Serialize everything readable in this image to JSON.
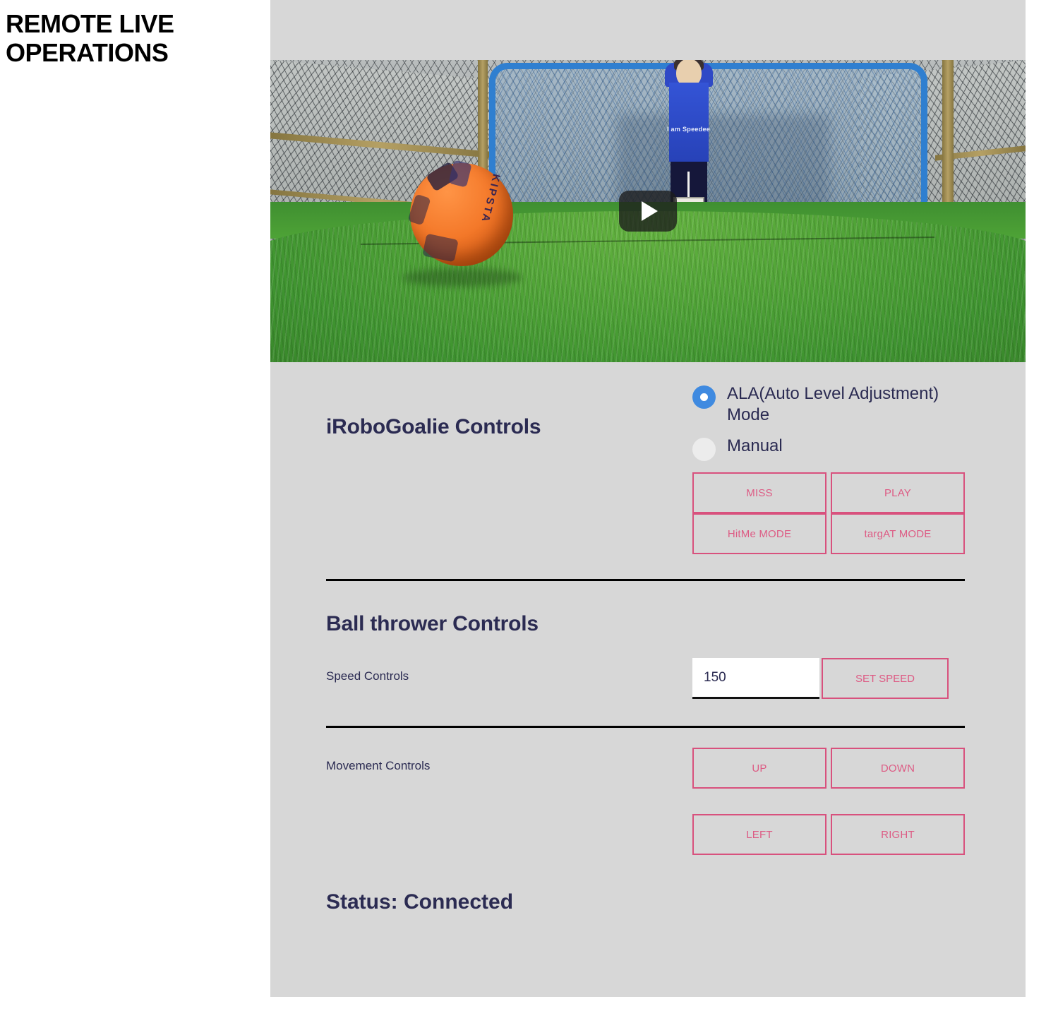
{
  "page": {
    "title": "REMOTE LIVE OPERATIONS",
    "background_color": "#ffffff",
    "card_color": "#d7d7d7"
  },
  "video": {
    "play_icon": "play-icon",
    "ball_brand": "KIPSTA",
    "goalie_text": "I am\nSpeedee"
  },
  "robogoalie": {
    "heading": "iRoboGoalie Controls",
    "modes": [
      {
        "label": "ALA(Auto Level Adjustment) Mode",
        "selected": true
      },
      {
        "label": "Manual",
        "selected": false
      }
    ],
    "buttons": [
      "MISS",
      "PLAY",
      "HitMe MODE",
      "targAT MODE"
    ]
  },
  "thrower": {
    "heading": "Ball thrower Controls",
    "speed_label": "Speed Controls",
    "speed_value": "150",
    "speed_placeholder": "150",
    "set_speed_label": "SET SPEED",
    "movement_label": "Movement Controls",
    "movement_buttons": [
      "UP",
      "DOWN",
      "LEFT",
      "RIGHT"
    ]
  },
  "status": {
    "text": "Status: Connected"
  },
  "colors": {
    "accent_pink": "#d8517d",
    "radio_blue": "#3f8ae0",
    "heading_navy": "#2b2b52"
  }
}
